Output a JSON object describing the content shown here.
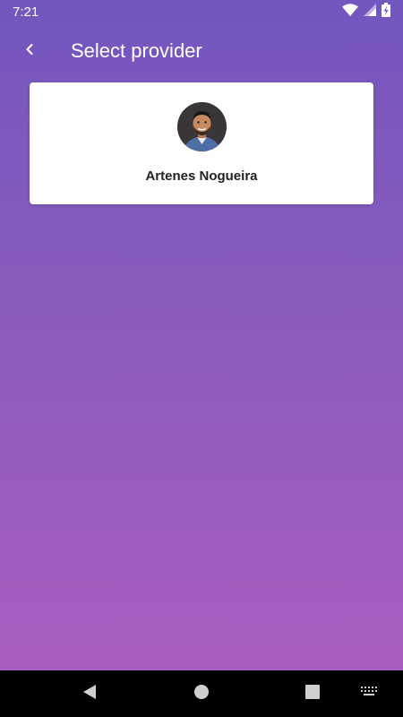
{
  "status_bar": {
    "time": "7:21",
    "icons": [
      "wifi-icon",
      "signal-icon",
      "battery-charging-icon"
    ]
  },
  "app_bar": {
    "back_icon": "chevron-left-icon",
    "title": "Select provider"
  },
  "providers": [
    {
      "name": "Artenes Nogueira",
      "avatar": "avatar-photo"
    }
  ],
  "nav_bar": {
    "icons": [
      "back-triangle-icon",
      "home-circle-icon",
      "recents-square-icon",
      "keyboard-icon"
    ]
  },
  "colors": {
    "gradient_top": "#7356bf",
    "gradient_bottom": "#a95dc0",
    "card": "#ffffff",
    "nav_bar": "#000000"
  }
}
